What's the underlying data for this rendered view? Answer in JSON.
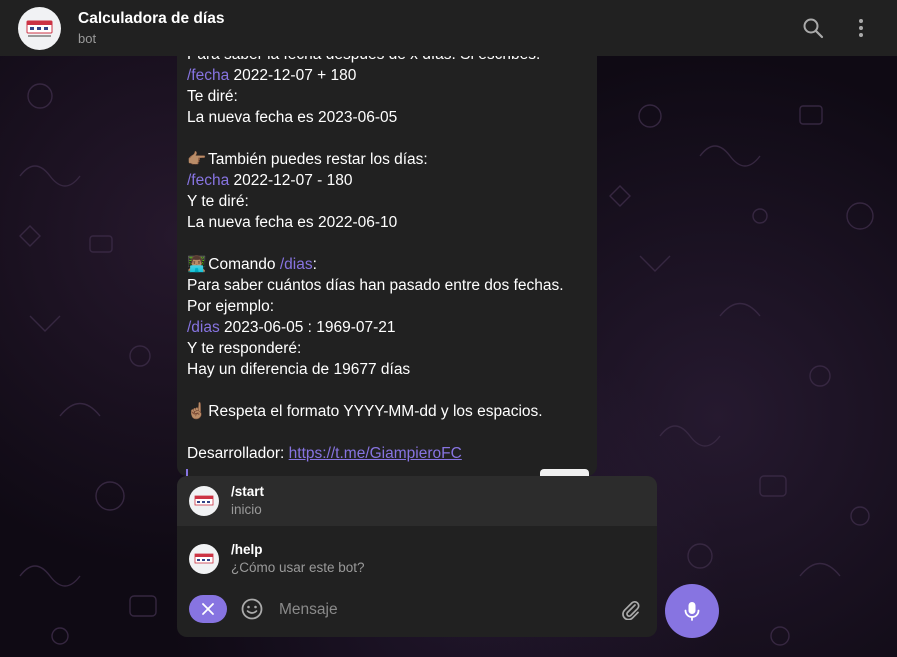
{
  "header": {
    "title": "Calculadora de días",
    "subtitle": "bot",
    "avatar_icon": "calendar-logo-icon",
    "search_icon": "search-icon",
    "menu_icon": "more-vertical-icon"
  },
  "message": {
    "lines": [
      {
        "type": "text",
        "text": "Para saber la fecha después de x días. Si escribes:"
      },
      {
        "type": "cmd",
        "cmd": "/fecha",
        "rest": " 2022-12-07 + 180"
      },
      {
        "type": "text",
        "text": "Te diré:"
      },
      {
        "type": "text",
        "text": "La nueva fecha es 2023-06-05"
      },
      {
        "type": "blank"
      },
      {
        "type": "emoji",
        "emoji": "👉🏽",
        "text": "También puedes restar los días:"
      },
      {
        "type": "cmd",
        "cmd": "/fecha",
        "rest": " 2022-12-07 - 180"
      },
      {
        "type": "text",
        "text": "Y te diré:"
      },
      {
        "type": "text",
        "text": "La nueva fecha es 2022-06-10"
      },
      {
        "type": "blank"
      },
      {
        "type": "emoji-cmd",
        "emoji": "👨🏽‍💻",
        "pre": "Comando ",
        "cmd": "/dias",
        "rest": ":"
      },
      {
        "type": "text",
        "text": "Para saber cuántos días han pasado entre dos fechas."
      },
      {
        "type": "text",
        "text": "Por ejemplo:"
      },
      {
        "type": "cmd",
        "cmd": "/dias",
        "rest": " 2023-06-05 : 1969-07-21"
      },
      {
        "type": "text",
        "text": "Y te responderé:"
      },
      {
        "type": "text",
        "text": "Hay un diferencia de 19677 días"
      },
      {
        "type": "blank"
      },
      {
        "type": "emoji",
        "emoji": "☝🏽",
        "text": "Respeta el formato YYYY-MM-dd y los espacios."
      },
      {
        "type": "blank"
      },
      {
        "type": "link",
        "pre": "Desarrollador: ",
        "link": "https://t.me/GiampieroFC"
      }
    ]
  },
  "suggestions": [
    {
      "cmd": "/start",
      "desc": "inicio"
    },
    {
      "cmd": "/help",
      "desc": "¿Cómo usar este bot?"
    }
  ],
  "composer": {
    "placeholder": "Mensaje",
    "close_icon": "close-icon",
    "emoji_icon": "smiley-icon",
    "attach_icon": "paperclip-icon",
    "mic_icon": "microphone-icon"
  },
  "colors": {
    "accent": "#8774e1",
    "panel": "#212121",
    "muted_text": "#9a9a9a"
  }
}
